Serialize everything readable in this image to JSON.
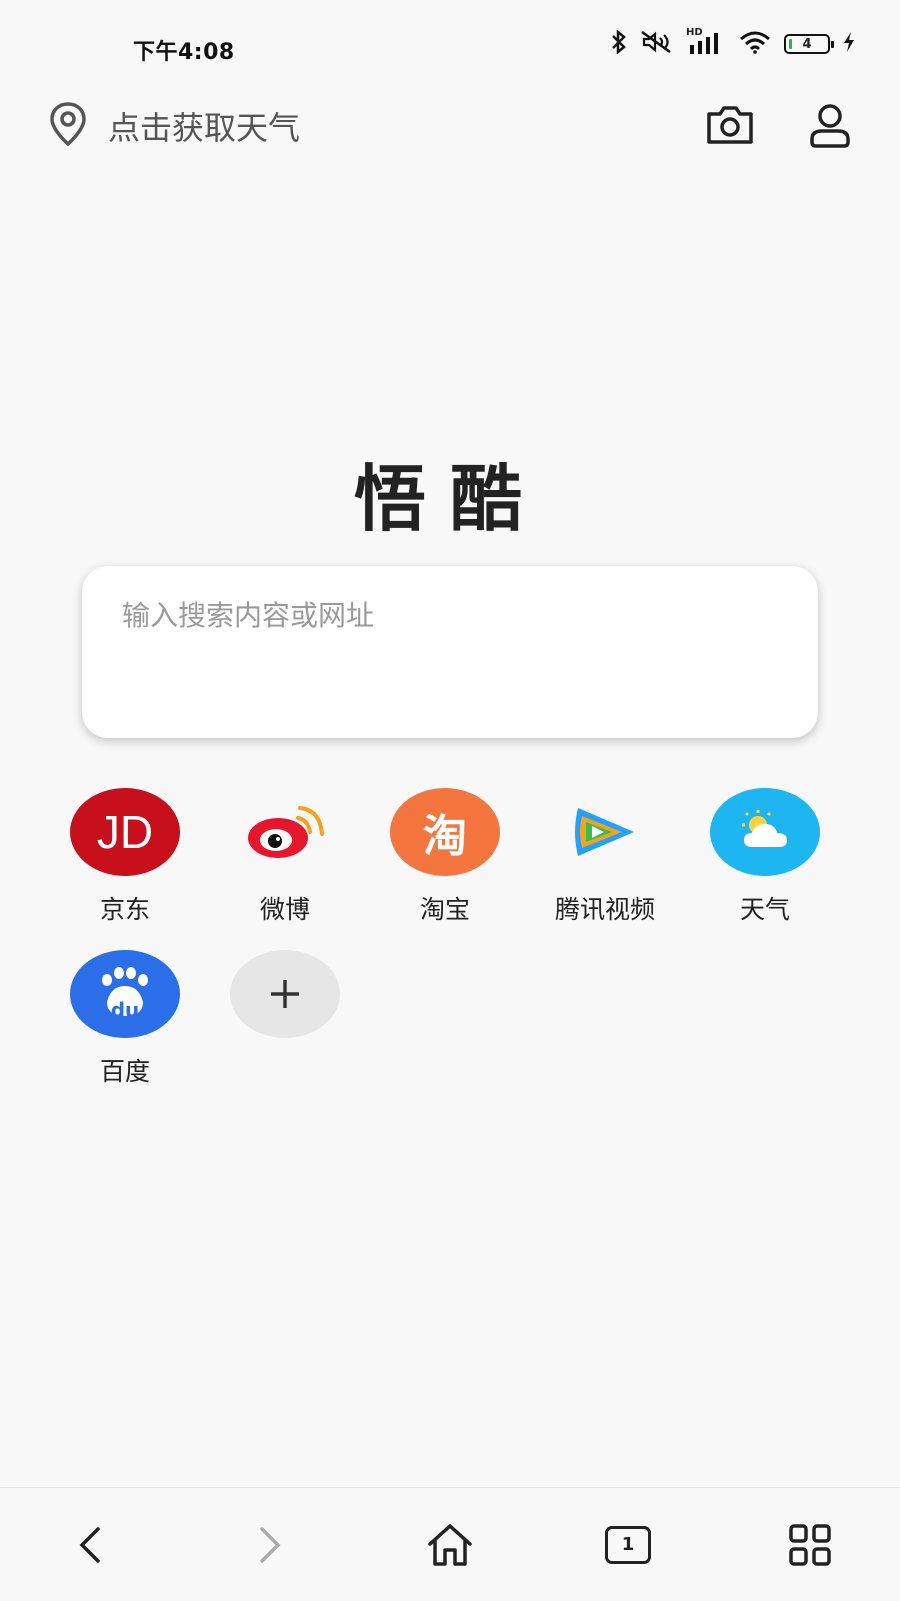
{
  "status_bar": {
    "time": "下午4:08",
    "battery_level": "4",
    "signal_label": "HD",
    "icons": [
      "bluetooth-icon",
      "mute-icon",
      "signal-icon",
      "wifi-icon",
      "battery-icon",
      "charging-icon"
    ]
  },
  "header": {
    "weather_text": "点击获取天气",
    "icons": [
      "location-pin-icon",
      "camera-icon",
      "user-icon"
    ]
  },
  "logo_text": "悟酷",
  "search": {
    "placeholder": "输入搜索内容或网址",
    "value": ""
  },
  "shortcuts": [
    {
      "label": "京东",
      "icon_text": "JD",
      "color": "#c8101d"
    },
    {
      "label": "微博",
      "icon": "weibo-icon",
      "color": "#e6162d"
    },
    {
      "label": "淘宝",
      "icon_text": "淘",
      "color": "#f4763e"
    },
    {
      "label": "腾讯视频",
      "icon": "tencent-video-icon",
      "color": "#20a0ff"
    },
    {
      "label": "天气",
      "icon": "weather-icon",
      "color": "#1eb6f0"
    },
    {
      "label": "百度",
      "icon_text": "du",
      "color": "#2a6ee8"
    },
    {
      "label": "",
      "icon": "add-icon",
      "color": "#e6e6e6"
    }
  ],
  "bottom_nav": {
    "tab_count": "1",
    "icons": [
      "back-icon",
      "forward-icon",
      "home-icon",
      "tabs-icon",
      "menu-grid-icon"
    ]
  }
}
